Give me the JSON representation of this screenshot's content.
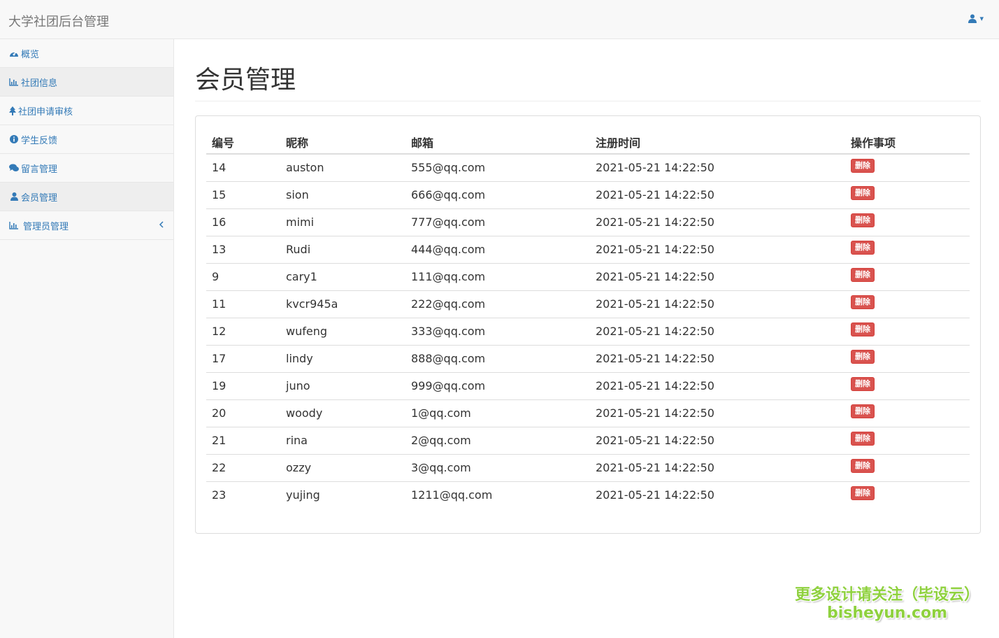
{
  "navbar": {
    "brand": "大学社团后台管理",
    "user_caret": "▾"
  },
  "sidebar": {
    "items": [
      {
        "label": "概览",
        "icon": "dashboard-icon"
      },
      {
        "label": "社团信息",
        "icon": "bar-chart-icon"
      },
      {
        "label": "社团申请审核",
        "icon": "tree-icon"
      },
      {
        "label": "学生反馈",
        "icon": "info-circle-icon"
      },
      {
        "label": "留言管理",
        "icon": "comments-icon"
      },
      {
        "label": "会员管理",
        "icon": "user-icon"
      },
      {
        "label": "管理员管理",
        "icon": "bar-chart-icon"
      }
    ]
  },
  "main": {
    "title": "会员管理",
    "table": {
      "headers": [
        "编号",
        "昵称",
        "邮箱",
        "注册时间",
        "操作事项"
      ],
      "delete_label": "删除",
      "rows": [
        [
          "14",
          "auston",
          "555@qq.com",
          "2021-05-21 14:22:50"
        ],
        [
          "15",
          "sion",
          "666@qq.com",
          "2021-05-21 14:22:50"
        ],
        [
          "16",
          "mimi",
          "777@qq.com",
          "2021-05-21 14:22:50"
        ],
        [
          "13",
          "Rudi",
          "444@qq.com",
          "2021-05-21 14:22:50"
        ],
        [
          "9",
          "cary1",
          "111@qq.com",
          "2021-05-21 14:22:50"
        ],
        [
          "11",
          "kvcr945a",
          "222@qq.com",
          "2021-05-21 14:22:50"
        ],
        [
          "12",
          "wufeng",
          "333@qq.com",
          "2021-05-21 14:22:50"
        ],
        [
          "17",
          "lindy",
          "888@qq.com",
          "2021-05-21 14:22:50"
        ],
        [
          "19",
          "juno",
          "999@qq.com",
          "2021-05-21 14:22:50"
        ],
        [
          "20",
          "woody",
          "1@qq.com",
          "2021-05-21 14:22:50"
        ],
        [
          "21",
          "rina",
          "2@qq.com",
          "2021-05-21 14:22:50"
        ],
        [
          "22",
          "ozzy",
          "3@qq.com",
          "2021-05-21 14:22:50"
        ],
        [
          "23",
          "yujing",
          "1211@qq.com",
          "2021-05-21 14:22:50"
        ]
      ]
    }
  },
  "watermark": {
    "line1": "更多设计请关注（毕设云）",
    "line2": "bisheyun.com"
  },
  "colors": {
    "link": "#337ab7",
    "danger": "#d9534f",
    "watermark": "#8fd13f"
  }
}
